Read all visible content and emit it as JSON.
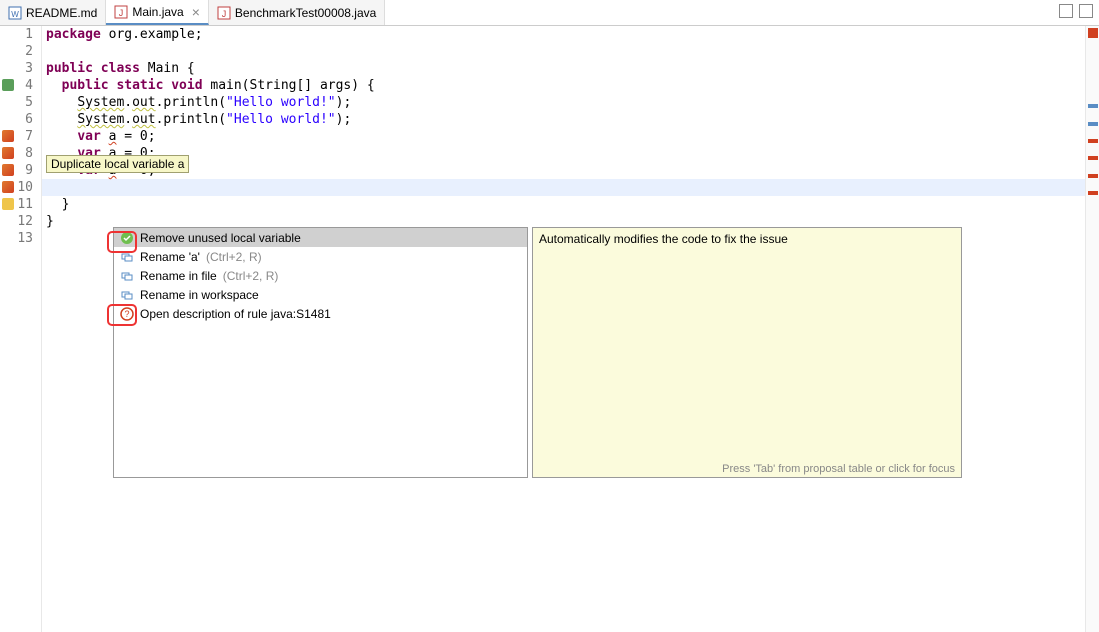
{
  "tabs": [
    {
      "label": "README.md",
      "icon": "doc",
      "active": false
    },
    {
      "label": "Main.java",
      "icon": "java",
      "active": true
    },
    {
      "label": "BenchmarkTest00008.java",
      "icon": "java",
      "active": false
    }
  ],
  "code": {
    "lines": [
      {
        "n": 1,
        "marker": "",
        "tokens": [
          {
            "t": "package",
            "c": "kw"
          },
          {
            "t": " org.example;",
            "c": "id"
          }
        ]
      },
      {
        "n": 2,
        "marker": "",
        "tokens": []
      },
      {
        "n": 3,
        "marker": "",
        "tokens": [
          {
            "t": "public class",
            "c": "kw"
          },
          {
            "t": " Main {",
            "c": "id"
          }
        ]
      },
      {
        "n": 4,
        "marker": "run",
        "tokens": [
          {
            "t": "  ",
            "c": ""
          },
          {
            "t": "public static void",
            "c": "kw"
          },
          {
            "t": " main(String[] args) {",
            "c": "id"
          }
        ]
      },
      {
        "n": 5,
        "marker": "",
        "tokens": [
          {
            "t": "    ",
            "c": ""
          },
          {
            "t": "System",
            "c": "squig"
          },
          {
            "t": ".",
            "c": "id"
          },
          {
            "t": "out",
            "c": "squig"
          },
          {
            "t": ".println(",
            "c": "id"
          },
          {
            "t": "\"Hello world!\"",
            "c": "str"
          },
          {
            "t": ");",
            "c": "id"
          }
        ]
      },
      {
        "n": 6,
        "marker": "",
        "tokens": [
          {
            "t": "    ",
            "c": ""
          },
          {
            "t": "System",
            "c": "squig"
          },
          {
            "t": ".",
            "c": "id"
          },
          {
            "t": "out",
            "c": "squig"
          },
          {
            "t": ".println(",
            "c": "id"
          },
          {
            "t": "\"Hello world!\"",
            "c": "str"
          },
          {
            "t": ");",
            "c": "id"
          }
        ]
      },
      {
        "n": 7,
        "marker": "bug",
        "tokens": [
          {
            "t": "    ",
            "c": ""
          },
          {
            "t": "var",
            "c": "kw"
          },
          {
            "t": " ",
            "c": ""
          },
          {
            "t": "a",
            "c": "squig-r"
          },
          {
            "t": " = 0;",
            "c": "id"
          }
        ]
      },
      {
        "n": 8,
        "marker": "bug",
        "tokens": [
          {
            "t": "    ",
            "c": ""
          },
          {
            "t": "var",
            "c": "kw"
          },
          {
            "t": " ",
            "c": ""
          },
          {
            "t": "a",
            "c": "squig-r"
          },
          {
            "t": " = 0;",
            "c": "id"
          }
        ]
      },
      {
        "n": 9,
        "marker": "bug",
        "tokens": [
          {
            "t": "    ",
            "c": ""
          },
          {
            "t": "var",
            "c": "kw"
          },
          {
            "t": " ",
            "c": ""
          },
          {
            "t": "a",
            "c": "squig-r"
          },
          {
            "t": " = 0;",
            "c": "id"
          }
        ]
      },
      {
        "n": 10,
        "marker": "bug",
        "tokens": [],
        "highlight": true
      },
      {
        "n": 11,
        "marker": "warn",
        "tokens": [
          {
            "t": "  }",
            "c": "id"
          }
        ]
      },
      {
        "n": 12,
        "marker": "",
        "tokens": [
          {
            "t": "}",
            "c": "id"
          }
        ]
      },
      {
        "n": 13,
        "marker": "",
        "tokens": []
      }
    ]
  },
  "tooltip": {
    "text": "Duplicate local variable a"
  },
  "quickfix": {
    "items": [
      {
        "label": "Remove unused local variable",
        "hint": "",
        "icon": "fix",
        "selected": true
      },
      {
        "label": "Rename 'a'",
        "hint": " (Ctrl+2, R)",
        "icon": "rename",
        "selected": false
      },
      {
        "label": "Rename in file",
        "hint": " (Ctrl+2, R)",
        "icon": "rename",
        "selected": false
      },
      {
        "label": "Rename in workspace",
        "hint": "",
        "icon": "rename",
        "selected": false
      },
      {
        "label": "Open description of rule java:S1481",
        "hint": "",
        "icon": "rule",
        "selected": false
      }
    ]
  },
  "description": {
    "body": "Automatically modifies the code to fix the issue",
    "footer": "Press 'Tab' from proposal table or click for focus"
  }
}
